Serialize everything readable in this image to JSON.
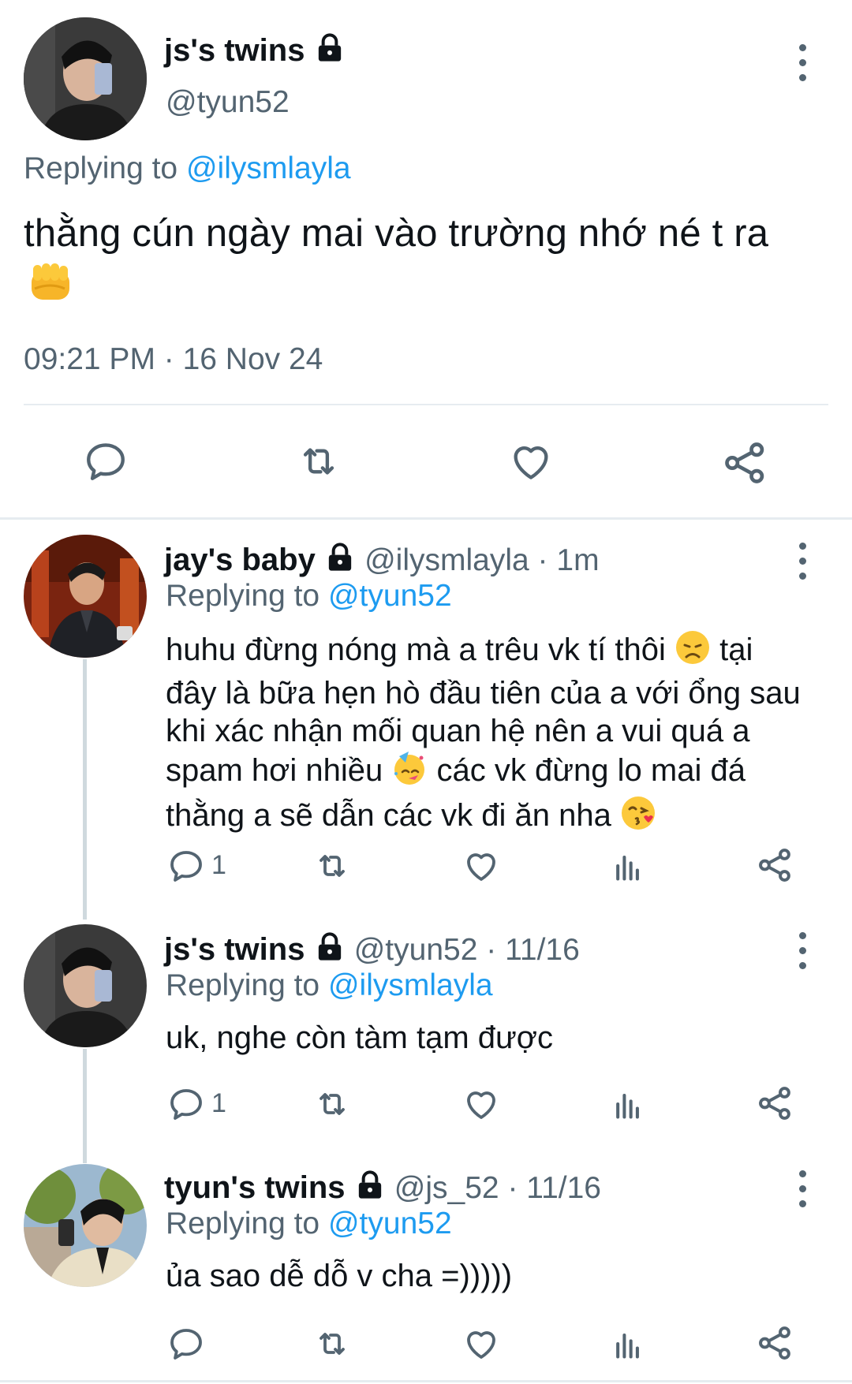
{
  "main_tweet": {
    "display_name": "js's twins",
    "handle": "@tyun52",
    "replying_prefix": "Replying to",
    "replying_to": "@ilysmlayla",
    "text": "thằng cún ngày mai vào trường nhớ né t ra",
    "emoji": "fist",
    "timestamp": "09:21 PM · 16 Nov 24",
    "actions": [
      "reply-icon",
      "retweet-icon",
      "like-icon",
      "share-icon"
    ]
  },
  "replies": [
    {
      "display_name": "jay's baby",
      "handle": "@ilysmlayla",
      "time": "1m",
      "replying_prefix": "Replying to",
      "replying_to": "@tyun52",
      "text_line1_a": "huhu đừng nóng mà a trêu vk tí thôi",
      "text_line1_b": "tại",
      "text_line2": "đây là bữa hẹn hò đầu tiên của a với ổng sau",
      "text_line3": "khi xác nhận mối quan hệ nên a vui quá a",
      "text_line4_a": "spam hơi nhiều",
      "text_line4_b": "các vk đừng lo mai đá",
      "text_line5": "thằng a sẽ dẫn các vk đi ăn nha",
      "reply_count": "1"
    },
    {
      "display_name": "js's twins",
      "handle": "@tyun52",
      "time": "11/16",
      "replying_prefix": "Replying to",
      "replying_to": "@ilysmlayla",
      "text": "uk, nghe còn tàm tạm được",
      "reply_count": "1"
    },
    {
      "display_name": "tyun's twins",
      "handle": "@js_52",
      "time": "11/16",
      "replying_prefix": "Replying to",
      "replying_to": "@tyun52",
      "text": "ủa sao dễ dỗ v cha =)))))",
      "reply_count": ""
    }
  ],
  "colors": {
    "accent": "#1d9bf0",
    "muted": "#536471",
    "divider": "#e6ecf0",
    "thread_line": "#cfd9de"
  }
}
